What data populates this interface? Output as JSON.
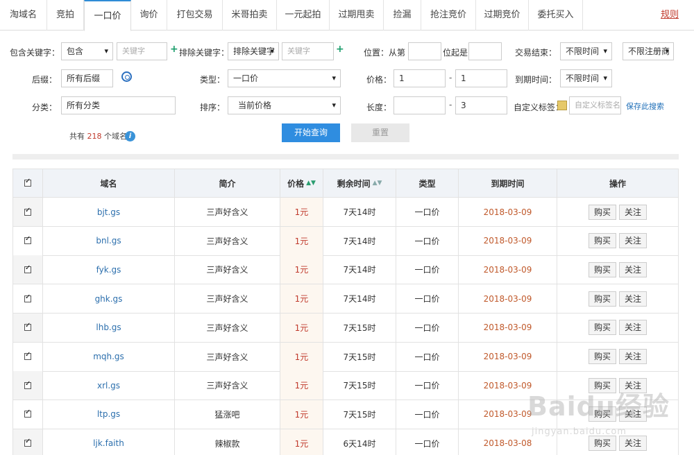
{
  "tabs": [
    {
      "label": "淘域名",
      "active": false
    },
    {
      "label": "竞拍",
      "active": false
    },
    {
      "label": "一口价",
      "active": true
    },
    {
      "label": "询价",
      "active": false
    },
    {
      "label": "打包交易",
      "active": false
    },
    {
      "label": "米哥拍卖",
      "active": false
    },
    {
      "label": "一元起拍",
      "active": false
    },
    {
      "label": "过期甩卖",
      "active": false
    },
    {
      "label": "捡漏",
      "active": false
    },
    {
      "label": "抢注竞价",
      "active": false
    },
    {
      "label": "过期竞价",
      "active": false
    },
    {
      "label": "委托买入",
      "active": false
    }
  ],
  "rules_link": "规则",
  "filters": {
    "include_keyword": {
      "label": "包含关键字：",
      "mode": "包含",
      "placeholder": "关键字"
    },
    "exclude_keyword": {
      "label": "排除关键字：",
      "mode": "排除关键字",
      "placeholder": "关键字"
    },
    "position": {
      "label": "位置：从第",
      "suffix": "位起是",
      "from": "",
      "value": ""
    },
    "trade_end": {
      "label": "交易结束：",
      "value": "不限时间",
      "reg_value": "不限注册商"
    },
    "suffix": {
      "label": "后缀：",
      "value": "所有后缀"
    },
    "type": {
      "label": "类型：",
      "value": "一口价"
    },
    "price": {
      "label": "价格：",
      "min": "1",
      "max": "1",
      "dash": "-"
    },
    "expire": {
      "label": "到期时间：",
      "value": "不限时间"
    },
    "category": {
      "label": "分类：",
      "value": "所有分类"
    },
    "sort": {
      "label": "排序：",
      "value": "当前价格"
    },
    "length": {
      "label": "长度：",
      "min": "",
      "max": "3",
      "dash": "-"
    },
    "custom_tag": {
      "label": "自定义标签：",
      "placeholder": "自定义标签名"
    },
    "save_search": "保存此搜索"
  },
  "summary": {
    "prefix": "共有",
    "count": "218",
    "suffix": "个域名"
  },
  "buttons": {
    "search": "开始查询",
    "reset": "重置"
  },
  "table": {
    "columns": [
      "域名",
      "简介",
      "价格",
      "剩余时间",
      "类型",
      "到期时间",
      "操作"
    ],
    "buy_label": "购买",
    "follow_label": "关注",
    "rows": [
      {
        "domain": "bjt.gs",
        "intro": "三声好含义",
        "price": "1元",
        "remaining": "7天14时",
        "type": "一口价",
        "expire": "2018-03-09"
      },
      {
        "domain": "bnl.gs",
        "intro": "三声好含义",
        "price": "1元",
        "remaining": "7天14时",
        "type": "一口价",
        "expire": "2018-03-09"
      },
      {
        "domain": "fyk.gs",
        "intro": "三声好含义",
        "price": "1元",
        "remaining": "7天14时",
        "type": "一口价",
        "expire": "2018-03-09"
      },
      {
        "domain": "ghk.gs",
        "intro": "三声好含义",
        "price": "1元",
        "remaining": "7天14时",
        "type": "一口价",
        "expire": "2018-03-09"
      },
      {
        "domain": "lhb.gs",
        "intro": "三声好含义",
        "price": "1元",
        "remaining": "7天15时",
        "type": "一口价",
        "expire": "2018-03-09"
      },
      {
        "domain": "mqh.gs",
        "intro": "三声好含义",
        "price": "1元",
        "remaining": "7天15时",
        "type": "一口价",
        "expire": "2018-03-09"
      },
      {
        "domain": "xrl.gs",
        "intro": "三声好含义",
        "price": "1元",
        "remaining": "7天15时",
        "type": "一口价",
        "expire": "2018-03-09"
      },
      {
        "domain": "ltp.gs",
        "intro": "猛涨吧",
        "price": "1元",
        "remaining": "7天15时",
        "type": "一口价",
        "expire": "2018-03-09"
      },
      {
        "domain": "ljk.faith",
        "intro": "辣椒款",
        "price": "1元",
        "remaining": "6天14时",
        "type": "一口价",
        "expire": "2018-03-08"
      }
    ]
  },
  "watermark": {
    "main": "Baidu经验",
    "sub": "jingyan.baidu.com"
  }
}
